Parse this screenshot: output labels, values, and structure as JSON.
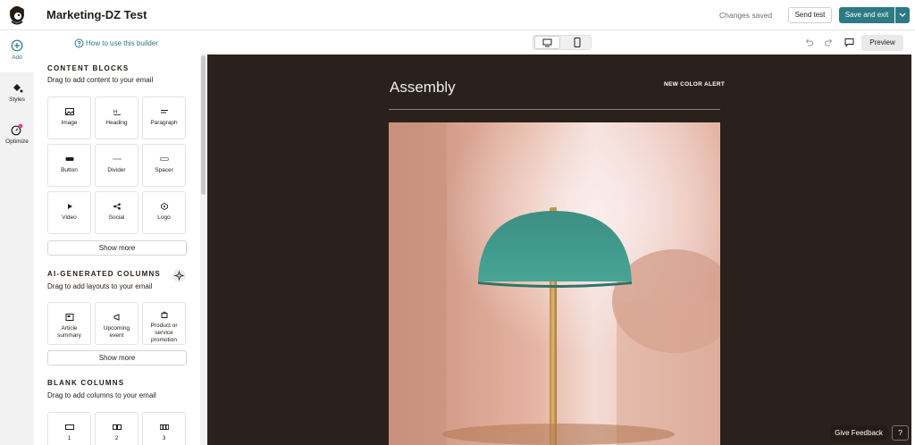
{
  "header": {
    "title": "Marketing-DZ Test",
    "status": "Changes saved",
    "send_test": "Send test",
    "save_exit": "Save and exit"
  },
  "rail": {
    "add": "Add",
    "styles": "Styles",
    "optimize": "Optimize"
  },
  "sidebar": {
    "howto": "How to use this builder",
    "content_blocks": {
      "title": "CONTENT BLOCKS",
      "subtitle": "Drag to add content to your email",
      "items": [
        {
          "label": "Image",
          "icon": "image-icon"
        },
        {
          "label": "Heading",
          "icon": "heading-icon"
        },
        {
          "label": "Paragraph",
          "icon": "paragraph-icon"
        },
        {
          "label": "Button",
          "icon": "button-icon"
        },
        {
          "label": "Divider",
          "icon": "divider-icon"
        },
        {
          "label": "Spacer",
          "icon": "spacer-icon"
        },
        {
          "label": "Video",
          "icon": "video-icon"
        },
        {
          "label": "Social",
          "icon": "share-icon"
        },
        {
          "label": "Logo",
          "icon": "logo-icon"
        }
      ],
      "show_more": "Show more"
    },
    "ai_columns": {
      "title": "AI-GENERATED COLUMNS",
      "subtitle": "Drag to add layouts to your email",
      "items": [
        {
          "label": "Article summary",
          "icon": "article-icon"
        },
        {
          "label": "Upcoming event",
          "icon": "megaphone-icon"
        },
        {
          "label": "Product or service promotion",
          "icon": "shopping-bag-icon"
        }
      ],
      "show_more": "Show more"
    },
    "blank_columns": {
      "title": "BLANK COLUMNS",
      "subtitle": "Drag to add columns to your email",
      "items": [
        {
          "label": "1"
        },
        {
          "label": "2"
        },
        {
          "label": "3"
        }
      ]
    }
  },
  "toolbar": {
    "preview": "Preview"
  },
  "email": {
    "brand": "Assembly",
    "alert": "NEW COLOR ALERT"
  },
  "footer": {
    "feedback": "Give Feedback",
    "help": "?"
  },
  "colors": {
    "accent": "#2c7a83",
    "canvas_bg": "#2a211c",
    "lamp_shade": "#3f9a8c",
    "wall": "#e8b9a4"
  }
}
